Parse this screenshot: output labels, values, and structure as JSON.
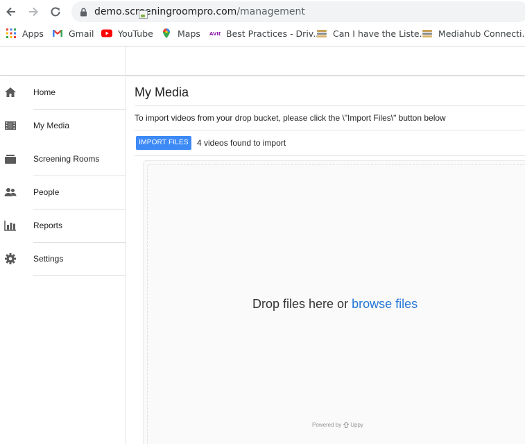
{
  "browser": {
    "url_host": "demo.screeningroompro.com",
    "url_path": "/management",
    "bookmarks": [
      {
        "label": "Apps",
        "icon": "apps-grid-icon"
      },
      {
        "label": "Gmail",
        "icon": "gmail-icon"
      },
      {
        "label": "YouTube",
        "icon": "youtube-icon"
      },
      {
        "label": "Maps",
        "icon": "maps-icon"
      },
      {
        "label": "Best Practices - Driv...",
        "icon": "avid-icon"
      },
      {
        "label": "Can I have the Liste...",
        "icon": "stack-icon"
      },
      {
        "label": "Mediahub Connecti...",
        "icon": "stack-icon"
      }
    ]
  },
  "sidebar": {
    "items": [
      {
        "label": "Home",
        "icon": "home-icon"
      },
      {
        "label": "My Media",
        "icon": "film-icon"
      },
      {
        "label": "Screening Rooms",
        "icon": "folder-icon"
      },
      {
        "label": "People",
        "icon": "people-icon"
      },
      {
        "label": "Reports",
        "icon": "bar-chart-icon"
      },
      {
        "label": "Settings",
        "icon": "gear-icon"
      }
    ]
  },
  "main": {
    "title": "My Media",
    "instructions": "To import videos from your drop bucket, please click the \\\"Import Files\\\" button below",
    "import_button": "IMPORT FILES",
    "found_text": "4 videos found to import"
  },
  "uploader": {
    "drop_text": "Drop files here or",
    "browse_link": "browse files",
    "powered_by": "Powered by",
    "brand": "Uppy"
  },
  "colors": {
    "accent": "#3d8af7",
    "link": "#2275d7",
    "sidebar_icon": "#5a5a5a"
  }
}
